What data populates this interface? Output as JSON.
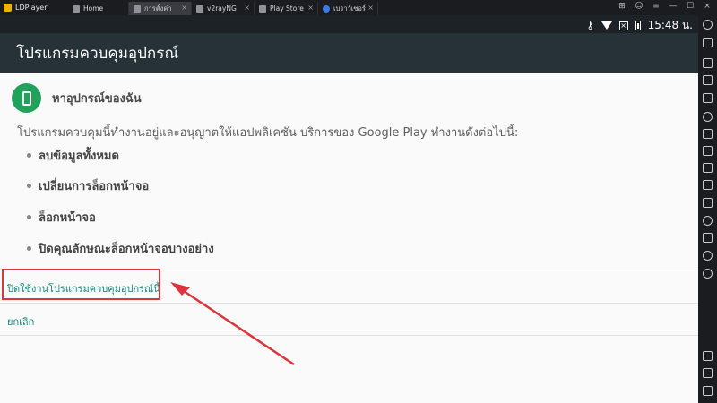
{
  "emulator": {
    "brand": "LDPlayer",
    "tabs": [
      {
        "label": "Home",
        "icon": "home-icon"
      },
      {
        "label": "การตั้งค่า",
        "icon": "settings-icon"
      },
      {
        "label": "v2rayNG",
        "icon": "v2ray-icon"
      },
      {
        "label": "Play Store",
        "icon": "play-store-icon"
      },
      {
        "label": "เบราว์เซอร์",
        "icon": "browser-icon"
      }
    ],
    "close_glyph": "×",
    "window_controls": [
      "⊞",
      "☺",
      "≡",
      "—",
      "☐",
      "×"
    ]
  },
  "status": {
    "time": "15:48 น.",
    "key_glyph": "⚷"
  },
  "appbar": {
    "title": "โปรแกรมควบคุมอุปกรณ์"
  },
  "admin": {
    "app_name": "หาอุปกรณ์ของฉัน",
    "description": "โปรแกรมควบคุมนี้ทำงานอยู่และอนุญาตให้แอปพลิเคชัน บริการของ Google Play ทำงานดังต่อไปนี้:",
    "permissions": [
      "ลบข้อมูลทั้งหมด",
      "เปลี่ยนการล็อกหน้าจอ",
      "ล็อกหน้าจอ",
      "ปิดคุณลักษณะล็อกหน้าจอบางอย่าง"
    ],
    "deactivate_label": "ปิดใช้งานโปรแกรมควบคุมอุปกรณ์นี้",
    "cancel_label": "ยกเลิก"
  },
  "colors": {
    "accent": "#168a78",
    "appbar": "#263238",
    "statusbar": "#1c2226",
    "admin_icon": "#21a15c",
    "annotation": "#d9363e"
  }
}
